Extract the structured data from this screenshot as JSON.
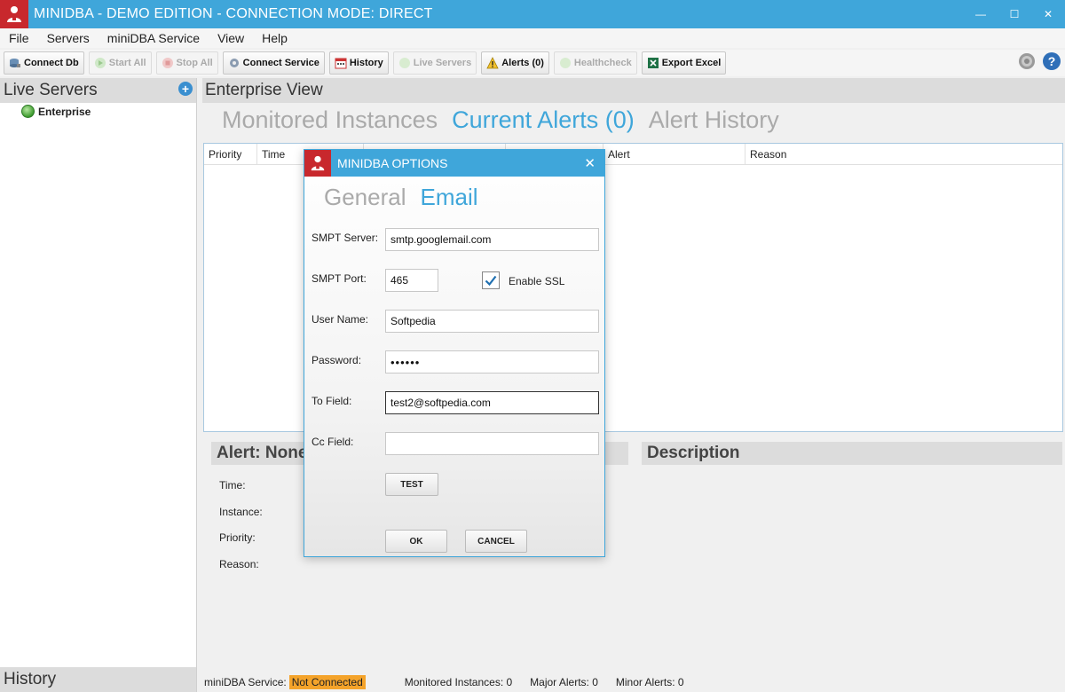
{
  "window": {
    "title": "MINIDBA - DEMO EDITION - CONNECTION MODE: DIRECT",
    "controls": {
      "minimize": "—",
      "maximize": "☐",
      "close": "✕"
    }
  },
  "menu": [
    "File",
    "Servers",
    "miniDBA Service",
    "View",
    "Help"
  ],
  "toolbar": {
    "connect_db": "Connect Db",
    "start_all": "Start All",
    "stop_all": "Stop All",
    "connect_service": "Connect Service",
    "history": "History",
    "live_servers": "Live Servers",
    "alerts": "Alerts (0)",
    "healthcheck": "Healthcheck",
    "export_excel": "Export Excel"
  },
  "left_panel": {
    "title": "Live Servers",
    "tree_item": "Enterprise",
    "history_title": "History"
  },
  "main": {
    "title": "Enterprise View",
    "tabs": [
      "Monitored Instances",
      "Current Alerts (0)",
      "Alert History"
    ],
    "active_tab": 1,
    "grid_columns": [
      "Priority",
      "Time",
      "",
      "",
      "Alert",
      "Reason"
    ],
    "alert_header": "Alert: None",
    "description_header": "Description",
    "detail_fields": [
      "Time:",
      "Instance:",
      "Priority:",
      "Reason:"
    ]
  },
  "status": {
    "service_label": "miniDBA Service:",
    "service_state": "Not Connected",
    "monitored": "Monitored Instances: 0",
    "major": "Major Alerts: 0",
    "minor": "Minor Alerts: 0"
  },
  "dialog": {
    "title": "MINIDBA OPTIONS",
    "close": "✕",
    "tabs": [
      "General",
      "Email"
    ],
    "active_tab": 1,
    "smtp_server_label": "SMPT Server:",
    "smtp_server_value": "smtp.googlemail.com",
    "smtp_port_label": "SMPT Port:",
    "smtp_port_value": "465",
    "enable_ssl_label": "Enable SSL",
    "enable_ssl_checked": true,
    "user_name_label": "User Name:",
    "user_name_value": "Softpedia",
    "password_label": "Password:",
    "password_value": "••••••",
    "to_field_label": "To Field:",
    "to_field_value": "test2@softpedia.com",
    "cc_field_label": "Cc Field:",
    "cc_field_value": "",
    "test_button": "TEST",
    "ok_button": "OK",
    "cancel_button": "CANCEL"
  },
  "colors": {
    "accent": "#3fa6da",
    "brand_red": "#c8282d",
    "status_warning": "#f4a32a"
  }
}
